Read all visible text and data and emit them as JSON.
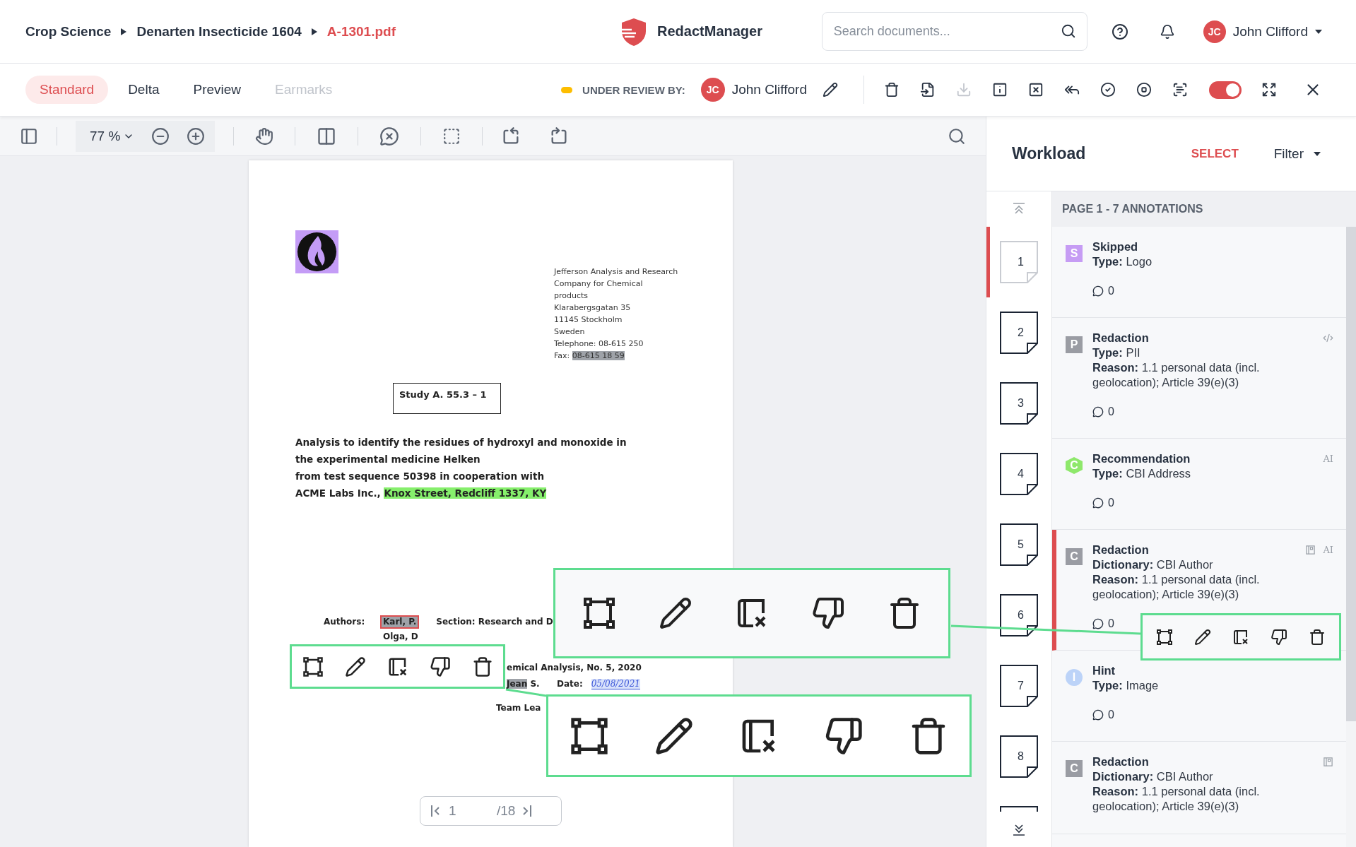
{
  "breadcrumb": [
    {
      "label": "Crop Science",
      "current": false
    },
    {
      "label": "Denarten Insecticide 1604",
      "current": false
    },
    {
      "label": "A-1301.pdf",
      "current": true
    }
  ],
  "app_name": "RedactManager",
  "search": {
    "placeholder": "Search documents..."
  },
  "user": {
    "initials": "JC",
    "name": "John Clifford"
  },
  "view_tabs": [
    {
      "label": "Standard",
      "selected": true,
      "disabled": false
    },
    {
      "label": "Delta",
      "selected": false,
      "disabled": false
    },
    {
      "label": "Preview",
      "selected": false,
      "disabled": false
    },
    {
      "label": "Earmarks",
      "selected": false,
      "disabled": true
    }
  ],
  "review": {
    "label": "UNDER REVIEW BY:",
    "initials": "JC",
    "name": "John Clifford"
  },
  "actions": [
    {
      "kind": "delete",
      "disabled": false
    },
    {
      "kind": "import",
      "disabled": false
    },
    {
      "kind": "download",
      "disabled": true
    },
    {
      "kind": "info",
      "disabled": false
    },
    {
      "kind": "remove",
      "disabled": false
    },
    {
      "kind": "reply",
      "disabled": false
    },
    {
      "kind": "approve",
      "disabled": false
    },
    {
      "kind": "stop",
      "disabled": false
    },
    {
      "kind": "scan",
      "disabled": false
    }
  ],
  "toggle": {
    "on": true
  },
  "zoom": "77 %",
  "document": {
    "address": [
      {
        "text": "Jefferson Analysis and Research"
      },
      {
        "text": "Company for Chemical"
      },
      {
        "text": "products"
      },
      {
        "text": "Klarabergsgatan 35"
      },
      {
        "text": "11145 Stockholm"
      },
      {
        "text": "Sweden"
      },
      {
        "text": "Telephone: 08-615 250"
      },
      {
        "text": "Fax:",
        "highlight": {
          "text": "08-615 18 59",
          "kind": "redaction"
        }
      }
    ],
    "study": "Study A. 55.3 – 1",
    "title": [
      {
        "text": "Analysis to identify the residues of hydroxyl and monoxide in"
      },
      {
        "text": "the experimental medicine Helken"
      },
      {
        "text": "from test sequence 50398 in cooperation with"
      },
      {
        "text": "ACME Labs Inc.,",
        "highlight": {
          "text": "Knox Street, Redcliff 1337, KY",
          "kind": "recommendation"
        }
      }
    ],
    "authors_label": "Authors:",
    "authors": [
      {
        "text": "Karl, P.",
        "kind": "redaction",
        "selected": true
      },
      {
        "text": "Olga, D",
        "kind": "plain",
        "selected": false
      }
    ],
    "section": "Section: Research and D",
    "publication": "emical Analysis, No. 5, 2020",
    "signer": {
      "text": "Jean",
      "kind": "redaction",
      "rest": "S."
    },
    "date_label": "Date:",
    "date": "05/08/2021",
    "role": "Team Lea"
  },
  "pager": {
    "page": "1",
    "total": "/18"
  },
  "workload": {
    "title": "Workload",
    "select": "SELECT",
    "filter": "Filter",
    "section": "PAGE 1 - 7 ANNOTATIONS"
  },
  "thumbnails": [
    {
      "label": "1",
      "selected": true
    },
    {
      "label": "2",
      "selected": false
    },
    {
      "label": "3",
      "selected": false
    },
    {
      "label": "4",
      "selected": false
    },
    {
      "label": "5",
      "selected": false
    },
    {
      "label": "6",
      "selected": false
    },
    {
      "label": "7",
      "selected": false
    },
    {
      "label": "8",
      "selected": false
    }
  ],
  "annotations": [
    {
      "kind": "square",
      "badge": "S",
      "color": "#c69cf4",
      "title": "Skipped",
      "details": [
        {
          "key": "Type:",
          "value": "Logo"
        }
      ],
      "comments": "0",
      "selected": false
    },
    {
      "kind": "square",
      "badge": "P",
      "color": "#9a9ca3",
      "title": "Redaction",
      "details": [
        {
          "key": "Type:",
          "value": "PII"
        },
        {
          "key": "Reason:",
          "value": "1.1 personal data (incl. geolocation); Article 39(e)(3)"
        }
      ],
      "comments": "0",
      "markers": [
        {
          "kind": "code"
        }
      ],
      "selected": false
    },
    {
      "kind": "hexagon",
      "badge": "C",
      "color": "#8ee86b",
      "title": "Recommendation",
      "details": [
        {
          "key": "Type:",
          "value": "CBI Address"
        }
      ],
      "comments": "0",
      "markers": [
        {
          "kind": "ai",
          "label": "AI"
        }
      ],
      "selected": false
    },
    {
      "kind": "square",
      "badge": "C",
      "color": "#9a9ca3",
      "title": "Redaction",
      "details": [
        {
          "key": "Dictionary:",
          "value": "CBI Author"
        },
        {
          "key": "Reason:",
          "value": "1.1 personal data (incl. geolocation); Article 39(e)(3)"
        }
      ],
      "comments": "0",
      "markers": [
        {
          "kind": "dictionary"
        },
        {
          "kind": "ai",
          "label": "AI"
        }
      ],
      "selected": true
    },
    {
      "kind": "circle",
      "badge": "I",
      "color": "#bcd3f8",
      "title": "Hint",
      "details": [
        {
          "key": "Type:",
          "value": "Image"
        }
      ],
      "comments": "0",
      "selected": false
    },
    {
      "kind": "square",
      "badge": "C",
      "color": "#9a9ca3",
      "title": "Redaction",
      "details": [
        {
          "key": "Dictionary:",
          "value": "CBI Author"
        },
        {
          "key": "Reason:",
          "value": "1.1 personal data (incl. geolocation); Article 39(e)(3)"
        }
      ],
      "markers": [
        {
          "kind": "dictionary"
        }
      ],
      "selected": false
    }
  ]
}
